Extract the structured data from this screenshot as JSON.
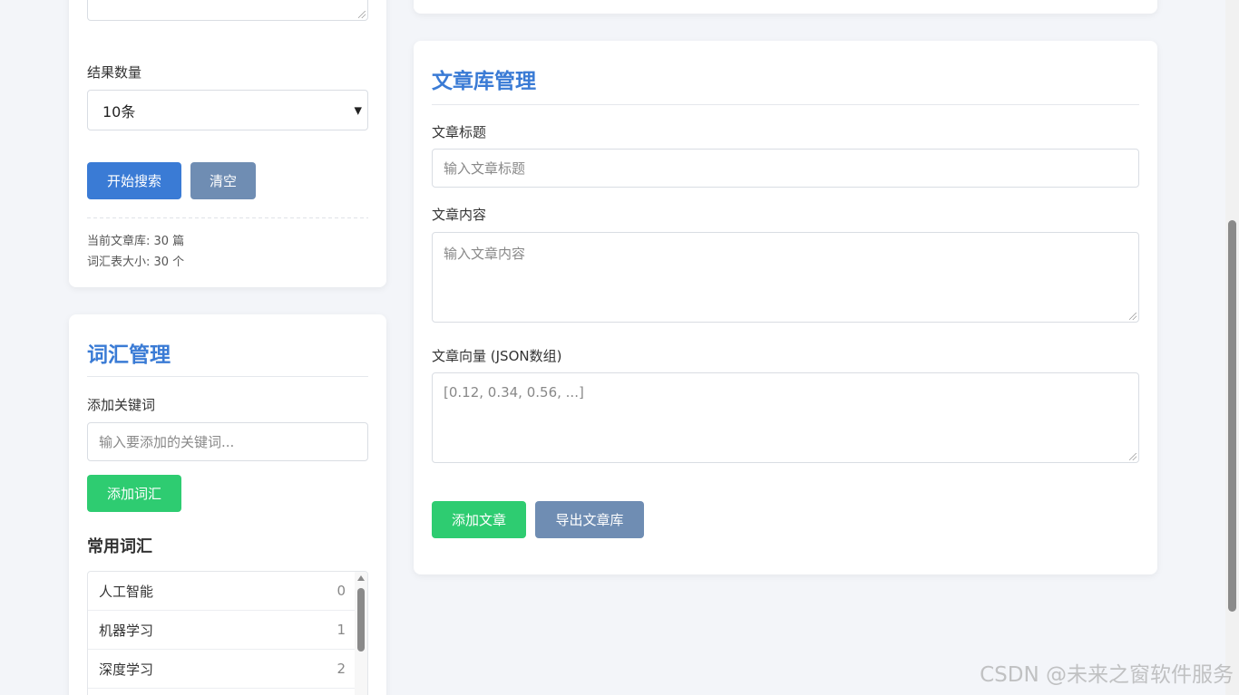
{
  "search_card": {
    "result_count_label": "结果数量",
    "result_count_value": "10条",
    "search_button": "开始搜索",
    "clear_button": "清空",
    "stats": {
      "article_count": "当前文章库: 30 篇",
      "vocab_size": "词汇表大小: 30 个"
    }
  },
  "vocab_card": {
    "title": "词汇管理",
    "add_keyword_label": "添加关键词",
    "add_keyword_placeholder": "输入要添加的关键词...",
    "add_button": "添加词汇",
    "common_title": "常用词汇",
    "items": [
      {
        "word": "人工智能",
        "count": "0"
      },
      {
        "word": "机器学习",
        "count": "1"
      },
      {
        "word": "深度学习",
        "count": "2"
      }
    ]
  },
  "article_card": {
    "title": "文章库管理",
    "title_label": "文章标题",
    "title_placeholder": "输入文章标题",
    "content_label": "文章内容",
    "content_placeholder": "输入文章内容",
    "vector_label": "文章向量 (JSON数组)",
    "vector_placeholder": "[0.12, 0.34, 0.56, ...]",
    "add_button": "添加文章",
    "export_button": "导出文章库"
  },
  "watermark": "CSDN @未来之窗软件服务",
  "colors": {
    "accent": "#3a7bd5",
    "gray_button": "#6f8db3",
    "green_button": "#2ecc71",
    "background": "#f3f5f9"
  }
}
